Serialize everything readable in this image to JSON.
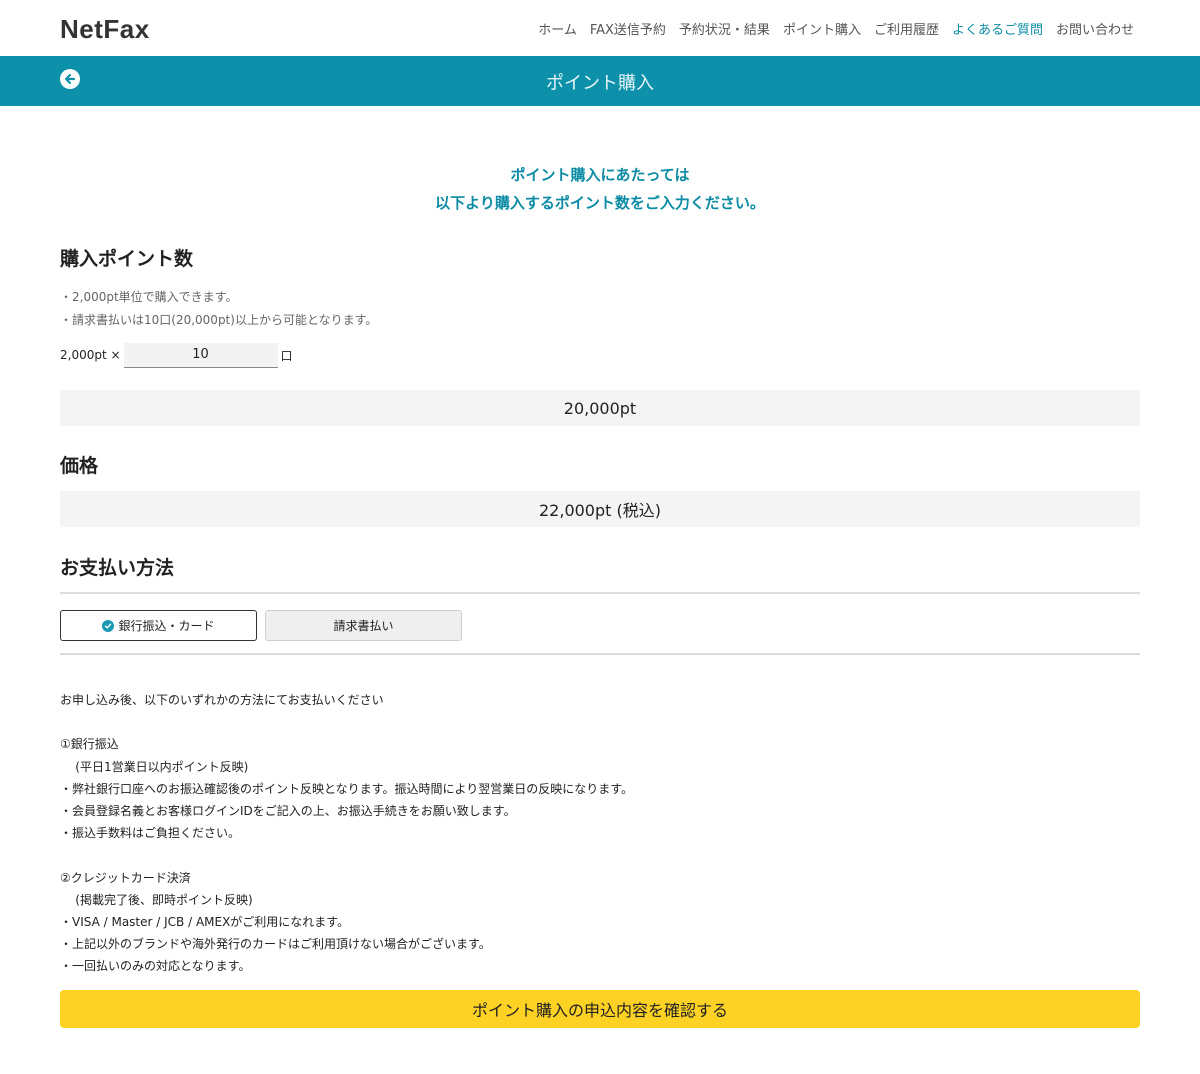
{
  "header": {
    "logo": "NetFax",
    "nav": [
      {
        "label": "ホーム"
      },
      {
        "label": "FAX送信予約"
      },
      {
        "label": "予約状況・結果"
      },
      {
        "label": "ポイント購入"
      },
      {
        "label": "ご利用履歴"
      },
      {
        "label": "よくあるご質問",
        "active": true
      },
      {
        "label": "お問い合わせ"
      }
    ]
  },
  "titlebar": {
    "title": "ポイント購入"
  },
  "intro": {
    "line1": "ポイント購入にあたっては",
    "line2": "以下より購入するポイント数をご入力ください。"
  },
  "purchase": {
    "heading": "購入ポイント数",
    "note1": "・2,000pt単位で購入できます。",
    "note2": "・請求書払いは10口(20,000pt)以上から可能となります。",
    "unit_prefix": "2,000pt ×",
    "quantity": "10",
    "unit_suffix": "口",
    "total": "20,000pt"
  },
  "price": {
    "heading": "価格",
    "value": "22,000pt (税込)"
  },
  "payment": {
    "heading": "お支払い方法",
    "options": [
      {
        "label": "銀行振込・カード",
        "selected": true
      },
      {
        "label": "請求書払い",
        "selected": false
      }
    ],
    "description": [
      "お申し込み後、以下のいずれかの方法にてお支払いください",
      "",
      "①銀行振込",
      "    (平日1営業日以内ポイント反映)",
      "・弊社銀行口座へのお振込確認後のポイント反映となります。振込時間により翌営業日の反映になります。",
      "・会員登録名義とお客様ログインIDをご記入の上、お振込手続きをお願い致します。",
      "・振込手数料はご負担ください。",
      "",
      "②クレジットカード決済",
      "    (掲載完了後、即時ポイント反映)",
      "・VISA / Master / JCB / AMEXがご利用になれます。",
      "・上記以外のブランドや海外発行のカードはご利用頂けない場合がございます。",
      "・一回払いのみの対応となります。"
    ]
  },
  "confirm_button": "ポイント購入の申込内容を確認する",
  "colors": {
    "teal": "#0d91ab",
    "accent_text": "#0c8ba5",
    "button_yellow": "#fdd225",
    "box_gray": "#f4f4f4"
  }
}
